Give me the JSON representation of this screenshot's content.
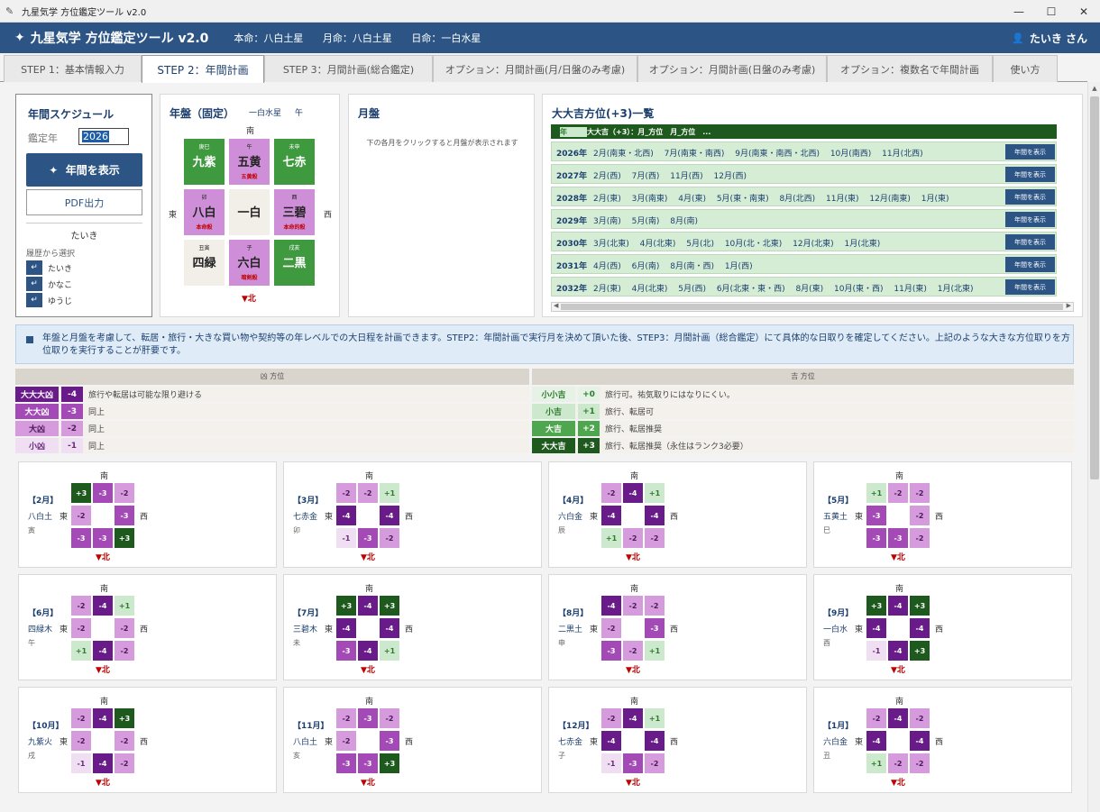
{
  "window": {
    "title": "九星気学 方位鑑定ツール v2.0"
  },
  "header": {
    "title": "九星気学 方位鑑定ツール v2.0",
    "honmei": "本命：八白土星",
    "getsumei": "月命：八白土星",
    "nichimei": "日命：一白水星",
    "user": "たいき さん"
  },
  "tabs": [
    {
      "label": "STEP 1：基本情報入力"
    },
    {
      "label": "STEP 2：年間計画"
    },
    {
      "label": "STEP 3：月間計画(総合鑑定)"
    },
    {
      "label": "オプション：月間計画(月/日盤のみ考慮)"
    },
    {
      "label": "オプション：月間計画(日盤のみ考慮)"
    },
    {
      "label": "オプション：複数名で年間計画"
    },
    {
      "label": "使い方"
    }
  ],
  "schedule": {
    "title": "年間スケジュール",
    "year_label": "鑑定年",
    "year_value": "2026",
    "show_button": "年間を表示",
    "pdf_button": "PDF出力",
    "user_name": "たいき",
    "history_label": "履歴から選択",
    "history": [
      "たいき",
      "かなこ",
      "ゆうじ"
    ]
  },
  "nenban": {
    "title": "年盤（固定）",
    "center_star": "一白水星",
    "eto": "午",
    "south": "南",
    "east": "東",
    "west": "西",
    "north": "▼北",
    "cells": [
      {
        "top": "庚巳",
        "star": "九紫",
        "note": "",
        "cls": "c2"
      },
      {
        "top": "午",
        "star": "五黄",
        "note": "五黄殺",
        "cls": "cm2"
      },
      {
        "top": "未申",
        "star": "七赤",
        "note": "",
        "cls": "c2"
      },
      {
        "top": "卯",
        "star": "八白",
        "note": "本命殺",
        "cls": "cm2"
      },
      {
        "top": "",
        "star": "一白",
        "note": "",
        "cls": "center"
      },
      {
        "top": "酉",
        "star": "三碧",
        "note": "本命的殺",
        "cls": "cm2"
      },
      {
        "top": "丑寅",
        "star": "四緑",
        "note": "",
        "cls": "center"
      },
      {
        "top": "子",
        "star": "六白",
        "note": "暗剣殺",
        "cls": "cm2"
      },
      {
        "top": "戌亥",
        "star": "二黒",
        "note": "",
        "cls": "c2"
      }
    ]
  },
  "tsukiban": {
    "title": "月盤",
    "message": "下の各月をクリックすると月盤が表示されます"
  },
  "daidaikichi": {
    "title": "大大吉方位(+3)一覧",
    "header_year": "年",
    "header_dirs": "大大吉（+3）：月_方位　月_方位　...",
    "button_label": "年間を表示",
    "rows": [
      {
        "year": "2026年",
        "dirs": "2月(南東・北西)　 7月(南東・南西)　 9月(南東・南西・北西)　 10月(南西)　 11月(北西)"
      },
      {
        "year": "2027年",
        "dirs": "2月(西)　 7月(西)　 11月(西)　 12月(西)"
      },
      {
        "year": "2028年",
        "dirs": "2月(東)　 3月(南東)　 4月(東)　 5月(東・南東)　 8月(北西)　 11月(東)　 12月(南東)　 1月(東)"
      },
      {
        "year": "2029年",
        "dirs": "3月(南)　 5月(南)　 8月(南)"
      },
      {
        "year": "2030年",
        "dirs": "3月(北東)　 4月(北東)　 5月(北)　 10月(北・北東)　 12月(北東)　 1月(北東)"
      },
      {
        "year": "2031年",
        "dirs": "4月(西)　 6月(南)　 8月(南・西)　 1月(西)"
      },
      {
        "year": "2032年",
        "dirs": "2月(東)　 4月(北東)　 5月(西)　 6月(北東・東・西)　 8月(東)　 10月(東・西)　 11月(東)　 1月(北東)"
      }
    ]
  },
  "info": {
    "text": "年盤と月盤を考慮して、転居・旅行・大きな買い物や契約等の年レベルでの大日程を計画できます。STEP2：年間計画で実行月を決めて頂いた後、STEP3：月間計画（総合鑑定）にて具体的な日取りを確定してください。上記のような大きな方位取りを方位取りを実行することが肝要です。"
  },
  "legend": {
    "kyo_title": "凶 方位",
    "kichi_title": "吉 方位",
    "kyo": [
      {
        "name": "大大大凶",
        "val": "-4",
        "text": "旅行や転居は可能な限り避ける",
        "cls": "cm4"
      },
      {
        "name": "大大凶",
        "val": "-3",
        "text": "同上",
        "cls": "cm3"
      },
      {
        "name": "大凶",
        "val": "-2",
        "text": "同上",
        "cls": "cm2"
      },
      {
        "name": "小凶",
        "val": "-1",
        "text": "同上",
        "cls": "cm1"
      }
    ],
    "kichi": [
      {
        "name": "小小吉",
        "val": "+0",
        "text": "旅行可。祐気取りにはなりにくい。",
        "cls": "c0"
      },
      {
        "name": "小吉",
        "val": "+1",
        "text": "旅行、転居可",
        "cls": "c1"
      },
      {
        "name": "大吉",
        "val": "+2",
        "text": "旅行、転居推奨",
        "cls": "c2"
      },
      {
        "name": "大大吉",
        "val": "+3",
        "text": "旅行、転居推奨（永住はランク3必要）",
        "cls": "c3"
      }
    ]
  },
  "months_labels": {
    "south": "南",
    "east": "東",
    "west": "西",
    "north": "▼北"
  },
  "months": [
    {
      "label": "【2月】",
      "star": "八白土",
      "eto": "寅",
      "cells": [
        "+3",
        "-3",
        "-2",
        "-2",
        "",
        "-3",
        "-3",
        "-3",
        "+3"
      ]
    },
    {
      "label": "【3月】",
      "star": "七赤金",
      "eto": "卯",
      "cells": [
        "-2",
        "-2",
        "+1",
        "-4",
        "",
        "-4",
        "-1",
        "-3",
        "-2"
      ]
    },
    {
      "label": "【4月】",
      "star": "六白金",
      "eto": "辰",
      "cells": [
        "-2",
        "-4",
        "+1",
        "-4",
        "",
        "-4",
        "+1",
        "-2",
        "-2"
      ]
    },
    {
      "label": "【5月】",
      "star": "五黄土",
      "eto": "巳",
      "cells": [
        "+1",
        "-2",
        "-2",
        "-3",
        "",
        "-2",
        "-3",
        "-3",
        "-2"
      ]
    },
    {
      "label": "【6月】",
      "star": "四緑木",
      "eto": "午",
      "cells": [
        "-2",
        "-4",
        "+1",
        "-2",
        "",
        "-2",
        "+1",
        "-4",
        "-2"
      ]
    },
    {
      "label": "【7月】",
      "star": "三碧木",
      "eto": "未",
      "cells": [
        "+3",
        "-4",
        "+3",
        "-4",
        "",
        "-4",
        "-3",
        "-4",
        "+1"
      ]
    },
    {
      "label": "【8月】",
      "star": "二黒土",
      "eto": "申",
      "cells": [
        "-4",
        "-2",
        "-2",
        "-2",
        "",
        "-3",
        "-3",
        "-2",
        "+1"
      ]
    },
    {
      "label": "【9月】",
      "star": "一白水",
      "eto": "酉",
      "cells": [
        "+3",
        "-4",
        "+3",
        "-4",
        "",
        "-4",
        "-1",
        "-4",
        "+3"
      ]
    },
    {
      "label": "【10月】",
      "star": "九紫火",
      "eto": "戌",
      "cells": [
        "-2",
        "-4",
        "+3",
        "-2",
        "",
        "-2",
        "-1",
        "-4",
        "-2"
      ]
    },
    {
      "label": "【11月】",
      "star": "八白土",
      "eto": "亥",
      "cells": [
        "-2",
        "-3",
        "-2",
        "-2",
        "",
        "-3",
        "-3",
        "-3",
        "+3"
      ]
    },
    {
      "label": "【12月】",
      "star": "七赤金",
      "eto": "子",
      "cells": [
        "-2",
        "-4",
        "+1",
        "-4",
        "",
        "-4",
        "-1",
        "-3",
        "-2"
      ]
    },
    {
      "label": "【1月】",
      "star": "六白金",
      "eto": "丑",
      "cells": [
        "-2",
        "-4",
        "-2",
        "-4",
        "",
        "-4",
        "+1",
        "-2",
        "-2"
      ]
    }
  ]
}
